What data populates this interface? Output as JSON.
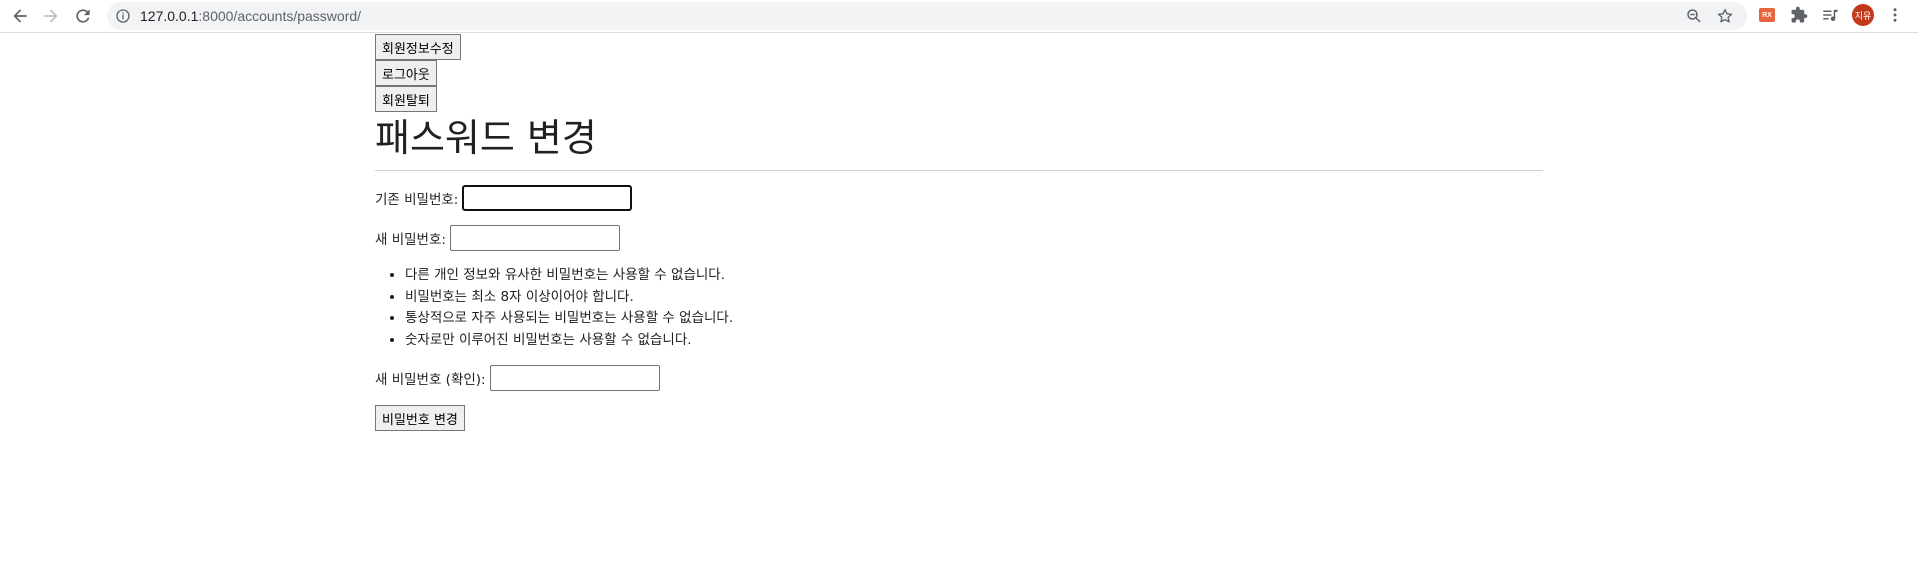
{
  "browser": {
    "url_host": "127.0.0.1",
    "url_path": ":8000/accounts/password/",
    "extension_badge": "RX",
    "profile_initials": "지유",
    "icons": [
      "back-arrow-icon",
      "forward-arrow-icon",
      "reload-icon",
      "info-icon",
      "zoom-icon",
      "star-icon",
      "puzzle-icon",
      "reading-list-icon",
      "kebab-menu-icon"
    ]
  },
  "nav": {
    "edit_profile": "회원정보수정",
    "logout": "로그아웃",
    "delete_account": "회원탈퇴"
  },
  "heading": "패스워드 변경",
  "form": {
    "old_password_label": "기존 비밀번호:",
    "new_password_label": "새 비밀번호:",
    "confirm_password_label": "새 비밀번호 (확인):",
    "help": [
      "다른 개인 정보와 유사한 비밀번호는 사용할 수 없습니다.",
      "비밀번호는 최소 8자 이상이어야 합니다.",
      "통상적으로 자주 사용되는 비밀번호는 사용할 수 없습니다.",
      "숫자로만 이루어진 비밀번호는 사용할 수 없습니다."
    ],
    "submit": "비밀번호 변경"
  }
}
